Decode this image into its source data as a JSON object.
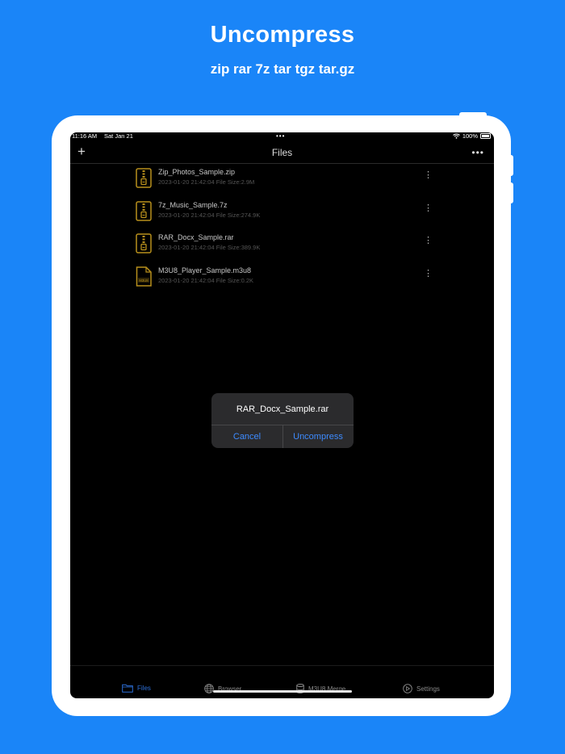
{
  "promo": {
    "headline": "Uncompress",
    "subline": "zip rar 7z tar tgz tar.gz"
  },
  "status_bar": {
    "time": "11:16 AM",
    "date": "Sat Jan 21",
    "battery": "100%",
    "dots": "•••"
  },
  "nav": {
    "add_icon": "plus-icon",
    "title": "Files",
    "more": "•••"
  },
  "files": [
    {
      "name": "Zip_Photos_Sample.zip",
      "meta": "2023-01-20 21:42:04 File Size:2.9M",
      "icon": "zip-archive-icon"
    },
    {
      "name": "7z_Music_Sample.7z",
      "meta": "2023-01-20 21:42:04 File Size:274.9K",
      "icon": "zip-archive-icon"
    },
    {
      "name": "RAR_Docx_Sample.rar",
      "meta": "2023-01-20 21:42:04 File Size:389.9K",
      "icon": "zip-archive-icon"
    },
    {
      "name": "M3U8_Player_Sample.m3u8",
      "meta": "2023-01-20 21:42:04 File Size:0.2K",
      "icon": "m3u8-file-icon",
      "icon_text": "M3U8"
    }
  ],
  "row_menu_glyph": "⋮",
  "alert": {
    "title": "RAR_Docx_Sample.rar",
    "cancel": "Cancel",
    "confirm": "Uncompress"
  },
  "tabs": {
    "files": "Files",
    "browser": "Browser",
    "merge": "M3U8 Merge",
    "settings": "Settings"
  },
  "colors": {
    "background": "#1a85f8",
    "accent": "#3d8bff",
    "file_icon": "#b8901c"
  }
}
